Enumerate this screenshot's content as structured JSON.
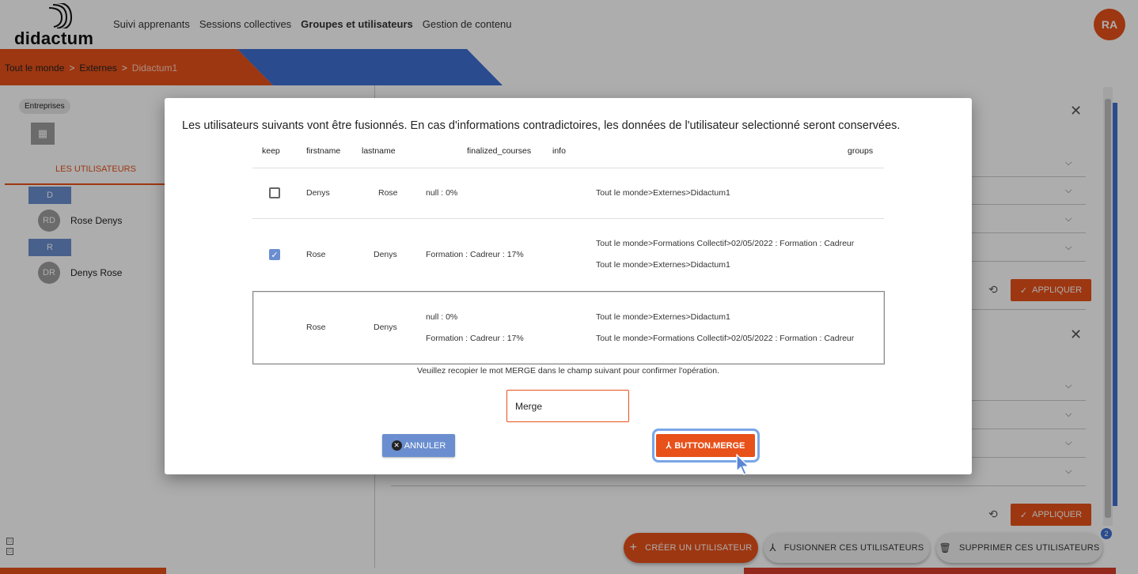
{
  "app": {
    "logo_text": "didactum",
    "nav": [
      "Suivi apprenants",
      "Sessions collectives",
      "Groupes et utilisateurs",
      "Gestion de contenu"
    ],
    "user_initials": "RA"
  },
  "breadcrumb": [
    "Tout le monde",
    "Externes",
    "Didactum1"
  ],
  "breadcrumb_sep": ">",
  "sidebar": {
    "chip": "Entreprises",
    "tab": "LES UTILISATEURS",
    "groups": [
      {
        "letter": "D",
        "user": {
          "initials": "RD",
          "name": "Rose Denys"
        }
      },
      {
        "letter": "R",
        "user": {
          "initials": "DR",
          "name": "Denys Rose"
        }
      }
    ]
  },
  "right_panel": {
    "apply_label": "APPLIQUER"
  },
  "fabs": {
    "create": "CRÉER UN UTILISATEUR",
    "merge": "FUSIONNER CES UTILISATEURS",
    "delete": "SUPPRIMER CES UTILISATEURS",
    "badge_count": "2"
  },
  "dialog": {
    "title": "Les utilisateurs suivants vont être fusionnés. En cas d'informations contradictoires, les données de l'utilisateur selectionné seront conservées.",
    "headers": {
      "keep": "keep",
      "firstname": "firstname",
      "lastname": "lastname",
      "finalized_courses": "finalized_courses",
      "info": "info",
      "groups": "groups"
    },
    "rows": [
      {
        "keep": false,
        "firstname": "Denys",
        "lastname": "Rose",
        "courses": [
          "null : 0%"
        ],
        "groups": [
          "Tout le monde>Externes>Didactum1"
        ]
      },
      {
        "keep": true,
        "firstname": "Rose",
        "lastname": "Denys",
        "courses": [
          "Formation : Cadreur : 17%"
        ],
        "groups": [
          "Tout le monde>Formations Collectif>02/05/2022 : Formation : Cadreur",
          "Tout le monde>Externes>Didactum1"
        ]
      }
    ],
    "merged": {
      "firstname": "Rose",
      "lastname": "Denys",
      "courses": [
        "null : 0%",
        "Formation : Cadreur : 17%"
      ],
      "groups": [
        "Tout le monde>Externes>Didactum1",
        "Tout le monde>Formations Collectif>02/05/2022 : Formation : Cadreur"
      ]
    },
    "confirm_text": "Veuillez recopier le mot MERGE dans le champ suivant pour confirmer l'opération.",
    "input_value": "Merge",
    "cancel_label": "ANNULER",
    "merge_label": "BUTTON.MERGE"
  },
  "colors": {
    "accent": "#e8511a",
    "blue": "#6a8ecf",
    "brand_blue": "#3f6fd1"
  }
}
